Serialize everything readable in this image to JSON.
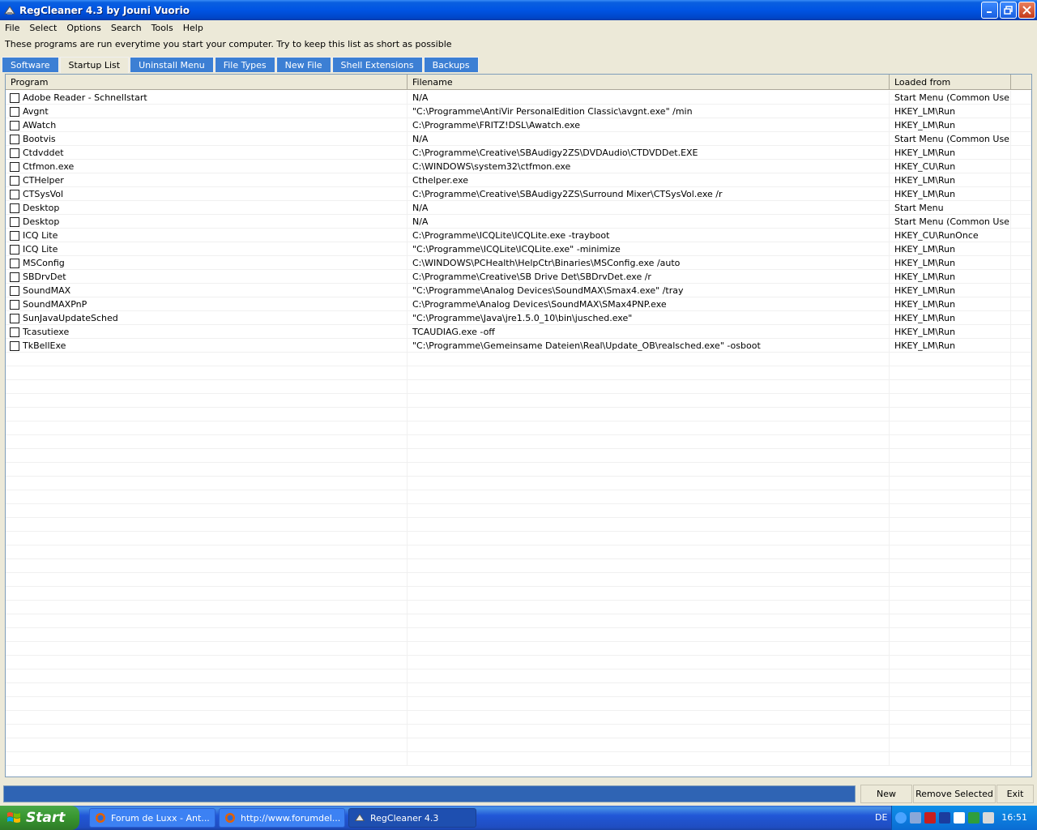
{
  "window": {
    "title": "RegCleaner 4.3 by Jouni Vuorio"
  },
  "menu": [
    "File",
    "Select",
    "Options",
    "Search",
    "Tools",
    "Help"
  ],
  "hint": "These programs are run everytime you start your computer. Try to keep this list as short as possible",
  "tabs": [
    {
      "label": "Software",
      "active": false
    },
    {
      "label": "Startup List",
      "active": true
    },
    {
      "label": "Uninstall Menu",
      "active": false
    },
    {
      "label": "File Types",
      "active": false
    },
    {
      "label": "New File",
      "active": false
    },
    {
      "label": "Shell Extensions",
      "active": false
    },
    {
      "label": "Backups",
      "active": false
    }
  ],
  "table": {
    "columns": [
      "Program",
      "Filename",
      "Loaded from"
    ],
    "rows": [
      {
        "program": "Adobe Reader - Schnellstart",
        "filename": "N/A",
        "loaded_from": "Start Menu (Common User)"
      },
      {
        "program": "Avgnt",
        "filename": "\"C:\\Programme\\AntiVir PersonalEdition Classic\\avgnt.exe\" /min",
        "loaded_from": "HKEY_LM\\Run"
      },
      {
        "program": "AWatch",
        "filename": "C:\\Programme\\FRITZ!DSL\\Awatch.exe",
        "loaded_from": "HKEY_LM\\Run"
      },
      {
        "program": "Bootvis",
        "filename": "N/A",
        "loaded_from": "Start Menu (Common User)"
      },
      {
        "program": "Ctdvddet",
        "filename": "C:\\Programme\\Creative\\SBAudigy2ZS\\DVDAudio\\CTDVDDet.EXE",
        "loaded_from": "HKEY_LM\\Run"
      },
      {
        "program": "Ctfmon.exe",
        "filename": "C:\\WINDOWS\\system32\\ctfmon.exe",
        "loaded_from": "HKEY_CU\\Run"
      },
      {
        "program": "CTHelper",
        "filename": "Cthelper.exe",
        "loaded_from": "HKEY_LM\\Run"
      },
      {
        "program": "CTSysVol",
        "filename": "C:\\Programme\\Creative\\SBAudigy2ZS\\Surround Mixer\\CTSysVol.exe /r",
        "loaded_from": "HKEY_LM\\Run"
      },
      {
        "program": "Desktop",
        "filename": "N/A",
        "loaded_from": "Start Menu"
      },
      {
        "program": "Desktop",
        "filename": "N/A",
        "loaded_from": "Start Menu (Common User)"
      },
      {
        "program": "ICQ Lite",
        "filename": "C:\\Programme\\ICQLite\\ICQLite.exe -trayboot",
        "loaded_from": "HKEY_CU\\RunOnce"
      },
      {
        "program": "ICQ Lite",
        "filename": "\"C:\\Programme\\ICQLite\\ICQLite.exe\" -minimize",
        "loaded_from": "HKEY_LM\\Run"
      },
      {
        "program": "MSConfig",
        "filename": "C:\\WINDOWS\\PCHealth\\HelpCtr\\Binaries\\MSConfig.exe /auto",
        "loaded_from": "HKEY_LM\\Run"
      },
      {
        "program": "SBDrvDet",
        "filename": "C:\\Programme\\Creative\\SB Drive Det\\SBDrvDet.exe /r",
        "loaded_from": "HKEY_LM\\Run"
      },
      {
        "program": "SoundMAX",
        "filename": "\"C:\\Programme\\Analog Devices\\SoundMAX\\Smax4.exe\" /tray",
        "loaded_from": "HKEY_LM\\Run"
      },
      {
        "program": "SoundMAXPnP",
        "filename": "C:\\Programme\\Analog Devices\\SoundMAX\\SMax4PNP.exe",
        "loaded_from": "HKEY_LM\\Run"
      },
      {
        "program": "SunJavaUpdateSched",
        "filename": "\"C:\\Programme\\Java\\jre1.5.0_10\\bin\\jusched.exe\"",
        "loaded_from": "HKEY_LM\\Run"
      },
      {
        "program": "Tcasutiexe",
        "filename": "TCAUDIAG.exe -off",
        "loaded_from": "HKEY_LM\\Run"
      },
      {
        "program": "TkBellExe",
        "filename": "\"C:\\Programme\\Gemeinsame Dateien\\Real\\Update_OB\\realsched.exe\"  -osboot",
        "loaded_from": "HKEY_LM\\Run"
      }
    ]
  },
  "buttons": {
    "new": "New",
    "remove_selected": "Remove Selected",
    "exit": "Exit"
  },
  "taskbar": {
    "start": "Start",
    "tasks": [
      {
        "label": "Forum de Luxx - Ant...",
        "active": false
      },
      {
        "label": "http://www.forumdel...",
        "active": false
      },
      {
        "label": "RegCleaner 4.3",
        "active": true
      }
    ],
    "language": "DE",
    "clock": "16:51"
  }
}
